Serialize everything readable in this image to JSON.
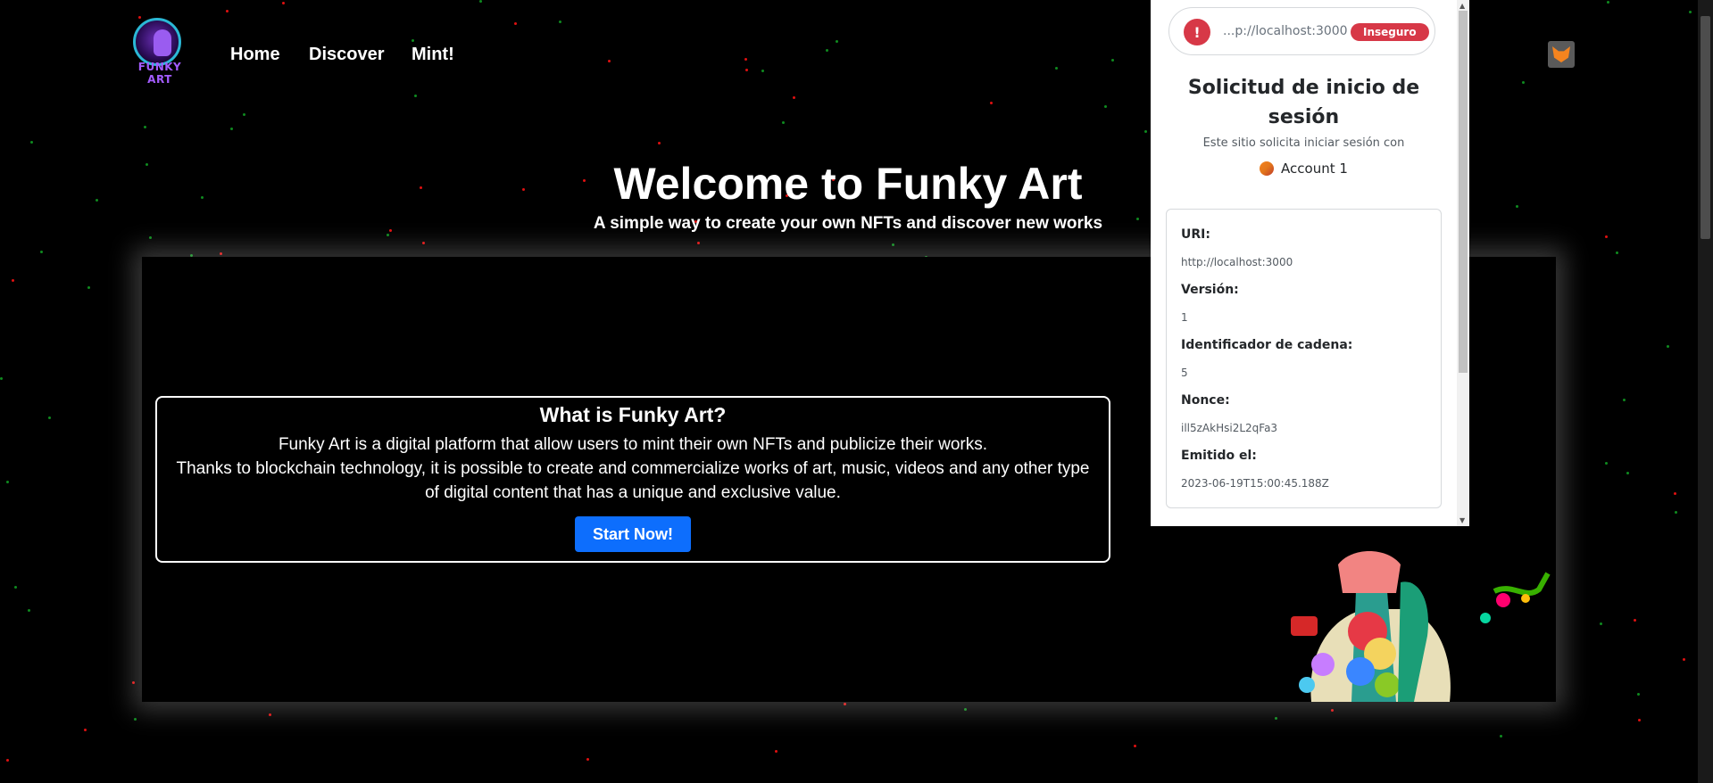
{
  "brand": {
    "logo_text": "FUNKY ART"
  },
  "nav": {
    "items": [
      "Home",
      "Discover",
      "Mint!"
    ]
  },
  "hero": {
    "title": "Welcome to Funky Art",
    "subtitle": "A simple way to create your own NFTs and discover new works"
  },
  "info": {
    "title": "What is Funky Art?",
    "line1": "Funky Art is a digital platform that allow users to mint their own NFTs and publicize their works.",
    "line2": "Thanks to blockchain technology, it is possible to create and commercialize works of art, music, videos and any other type of digital content that has a unique and exclusive value.",
    "button": "Start Now!"
  },
  "wallet_popup": {
    "site_url": "...p://localhost:3000",
    "badge": "Inseguro",
    "title": "Solicitud de inicio de sesión",
    "description": "Este sitio solicita iniciar sesión con",
    "account": "Account 1",
    "details": [
      {
        "label": "URI:",
        "value": "http://localhost:3000"
      },
      {
        "label": "Versión:",
        "value": "1"
      },
      {
        "label": "Identificador de cadena:",
        "value": "5"
      },
      {
        "label": "Nonce:",
        "value": "ill5zAkHsi2L2qFa3"
      },
      {
        "label": "Emitido el:",
        "value": "2023-06-19T15:00:45.188Z"
      }
    ]
  },
  "colors": {
    "background": "#000000",
    "primary_button": "#0d6efd",
    "danger": "#d73847",
    "logo_accent": "#a35cff"
  },
  "icons": {
    "warning": "warning-icon",
    "extension": "metamask-fox-icon",
    "account": "account-avatar-icon"
  }
}
